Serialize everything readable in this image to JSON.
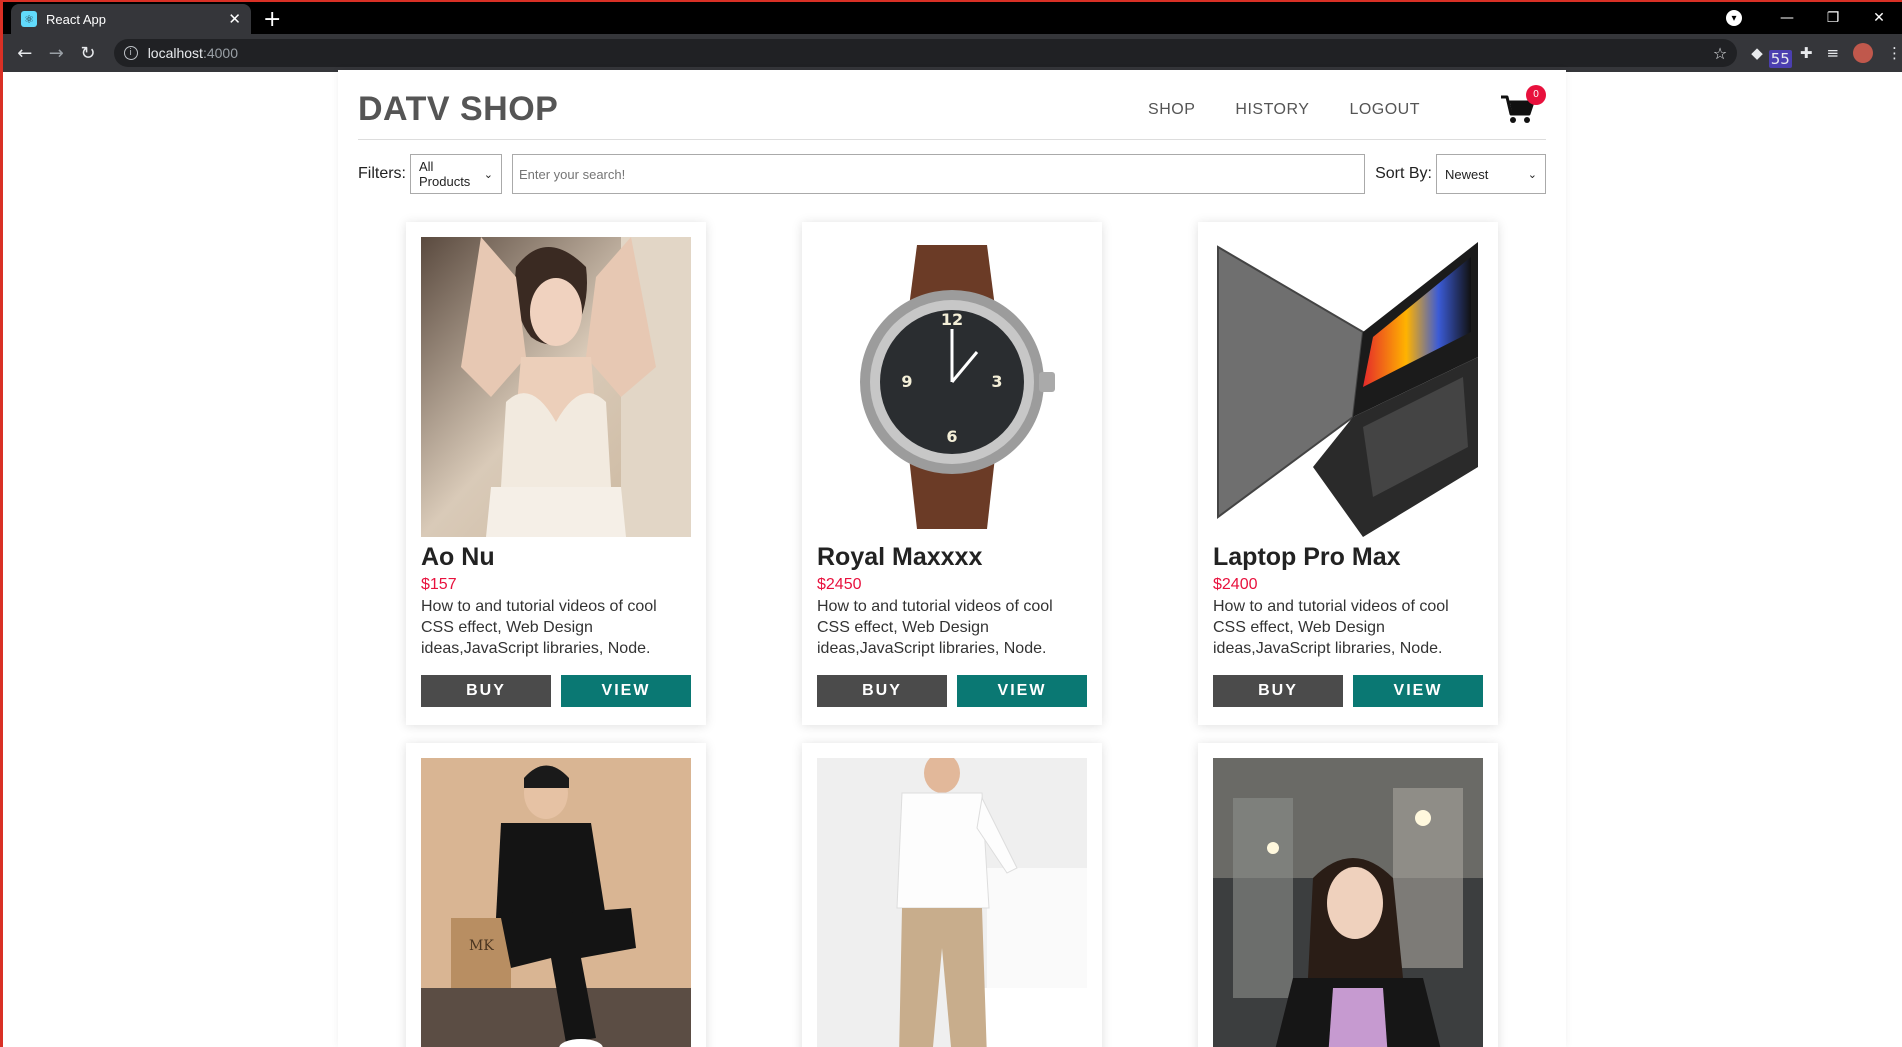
{
  "browser": {
    "tab_title": "React App",
    "tab_close": "✕",
    "new_tab": "+",
    "url_host": "localhost",
    "url_port": ":4000",
    "extension_badge": "55",
    "favicon": "react-icon",
    "window_controls": [
      "—",
      "❐",
      "✕"
    ]
  },
  "header": {
    "logo": "DATV SHOP",
    "nav": [
      "SHOP",
      "HISTORY",
      "LOGOUT"
    ],
    "cart_count": "0"
  },
  "filters": {
    "label": "Filters:",
    "category_selected": "All Products",
    "search_placeholder": "Enter your search!",
    "sort_label": "Sort By:",
    "sort_selected": "Newest"
  },
  "products": [
    {
      "title": "Ao Nu",
      "price": "$157",
      "desc": "How to and tutorial videos of cool CSS effect, Web Design ideas,JavaScript libraries, Node.",
      "buy": "BUY",
      "view": "VIEW"
    },
    {
      "title": "Royal Maxxxx",
      "price": "$2450",
      "desc": "How to and tutorial videos of cool CSS effect, Web Design ideas,JavaScript libraries, Node.",
      "buy": "BUY",
      "view": "VIEW"
    },
    {
      "title": "Laptop Pro Max",
      "price": "$2400",
      "desc": "How to and tutorial videos of cool CSS effect, Web Design ideas,JavaScript libraries, Node.",
      "buy": "BUY",
      "view": "VIEW"
    },
    {
      "title": "",
      "price": "",
      "desc": "",
      "buy": "",
      "view": ""
    },
    {
      "title": "",
      "price": "",
      "desc": "",
      "buy": "",
      "view": ""
    },
    {
      "title": "",
      "price": "",
      "desc": "",
      "buy": "",
      "view": ""
    }
  ],
  "colors": {
    "accent": "#0a7873",
    "buy": "#4b4b4b",
    "price": "#e8113d",
    "badge": "#e8113d"
  }
}
